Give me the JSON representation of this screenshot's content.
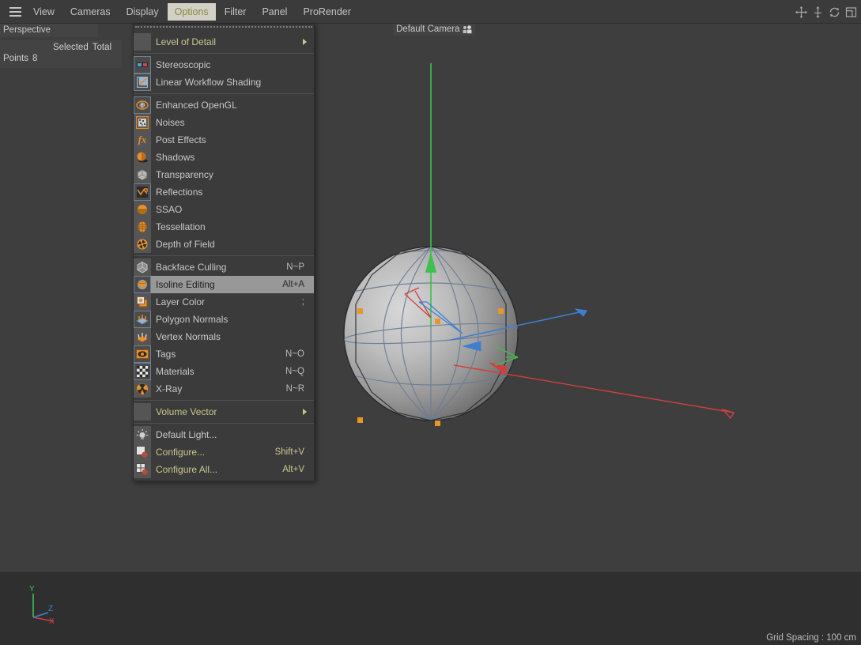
{
  "menubar": {
    "hamburger_icon": "hamburger-icon",
    "items": [
      {
        "label": "View",
        "active": false
      },
      {
        "label": "Cameras",
        "active": false
      },
      {
        "label": "Display",
        "active": false
      },
      {
        "label": "Options",
        "active": true
      },
      {
        "label": "Filter",
        "active": false
      },
      {
        "label": "Panel",
        "active": false
      },
      {
        "label": "ProRender",
        "active": false
      }
    ],
    "viewport_icons": [
      {
        "name": "pan-icon",
        "title": "Move"
      },
      {
        "name": "dolly-icon",
        "title": "Scale"
      },
      {
        "name": "rotate-icon",
        "title": "Rotate"
      },
      {
        "name": "maximize-icon",
        "title": "Toggle Active View"
      }
    ]
  },
  "viewport": {
    "perspective_label": "Perspective",
    "stats": {
      "col_selected": "Selected",
      "col_total": "Total",
      "row_label": "Points",
      "row_value": "8"
    },
    "camera_label": "Default Camera",
    "grid_spacing": "Grid Spacing : 100 cm",
    "axis": {
      "y": "Y",
      "x": "X",
      "z": "Z"
    },
    "colors": {
      "background_upper": "#3e3e3e",
      "background_lower": "#2f2f2f",
      "axis_x": "#d04040",
      "axis_y": "#3fc04f",
      "axis_z": "#3f7fd0",
      "point_marker": "#e8962a",
      "wireframe": "#6a7c96"
    }
  },
  "dropdown": {
    "tearoff": true,
    "groups": [
      {
        "items": [
          {
            "label": "Level of Detail",
            "shortcut": "",
            "icon": "lod-icon",
            "icon_style": "plain",
            "submenu": true,
            "gold": true,
            "highlight": false
          }
        ]
      },
      {
        "items": [
          {
            "label": "Stereoscopic",
            "shortcut": "",
            "icon": "stereo-glasses-icon",
            "icon_style": "framed",
            "submenu": false,
            "gold": false,
            "highlight": false
          },
          {
            "label": "Linear Workflow Shading",
            "shortcut": "",
            "icon": "linear-workflow-icon",
            "icon_style": "framed",
            "submenu": false,
            "gold": false,
            "highlight": false
          }
        ]
      },
      {
        "items": [
          {
            "label": "Enhanced OpenGL",
            "shortcut": "",
            "icon": "opengl-icon",
            "icon_style": "framed",
            "submenu": false,
            "gold": false,
            "highlight": false
          },
          {
            "label": "Noises",
            "shortcut": "",
            "icon": "noises-icon",
            "icon_style": "plain",
            "submenu": false,
            "gold": false,
            "highlight": false
          },
          {
            "label": "Post Effects",
            "shortcut": "",
            "icon": "fx-icon",
            "icon_style": "plain",
            "submenu": false,
            "gold": false,
            "highlight": false
          },
          {
            "label": "Shadows",
            "shortcut": "",
            "icon": "shadows-icon",
            "icon_style": "plain",
            "submenu": false,
            "gold": false,
            "highlight": false
          },
          {
            "label": "Transparency",
            "shortcut": "",
            "icon": "transparency-cube-icon",
            "icon_style": "plain",
            "submenu": false,
            "gold": false,
            "highlight": false
          },
          {
            "label": "Reflections",
            "shortcut": "",
            "icon": "reflections-icon",
            "icon_style": "framed",
            "submenu": false,
            "gold": false,
            "highlight": false
          },
          {
            "label": "SSAO",
            "shortcut": "",
            "icon": "ssao-icon",
            "icon_style": "plain",
            "submenu": false,
            "gold": false,
            "highlight": false
          },
          {
            "label": "Tessellation",
            "shortcut": "",
            "icon": "tessellation-icon",
            "icon_style": "plain",
            "submenu": false,
            "gold": false,
            "highlight": false
          },
          {
            "label": "Depth of Field",
            "shortcut": "",
            "icon": "aperture-icon",
            "icon_style": "plain",
            "submenu": false,
            "gold": false,
            "highlight": false
          }
        ]
      },
      {
        "items": [
          {
            "label": "Backface Culling",
            "shortcut": "N~P",
            "icon": "wire-cube-icon",
            "icon_style": "plain",
            "submenu": false,
            "gold": false,
            "highlight": false
          },
          {
            "label": "Isoline Editing",
            "shortcut": "Alt+A",
            "icon": "isoline-icon",
            "icon_style": "framed",
            "submenu": false,
            "gold": false,
            "highlight": true
          },
          {
            "label": "Layer Color",
            "shortcut": ";",
            "icon": "layer-color-icon",
            "icon_style": "plain",
            "submenu": false,
            "gold": false,
            "highlight": false
          },
          {
            "label": "Polygon Normals",
            "shortcut": "",
            "icon": "polygon-normals-icon",
            "icon_style": "framed",
            "submenu": false,
            "gold": false,
            "highlight": false
          },
          {
            "label": "Vertex Normals",
            "shortcut": "",
            "icon": "vertex-normals-icon",
            "icon_style": "plain",
            "submenu": false,
            "gold": false,
            "highlight": false
          },
          {
            "label": "Tags",
            "shortcut": "N~O",
            "icon": "eye-icon",
            "icon_style": "framed",
            "submenu": false,
            "gold": false,
            "highlight": false
          },
          {
            "label": "Materials",
            "shortcut": "N~Q",
            "icon": "checker-icon",
            "icon_style": "framed",
            "submenu": false,
            "gold": false,
            "highlight": false
          },
          {
            "label": "X-Ray",
            "shortcut": "N~R",
            "icon": "xray-icon",
            "icon_style": "plain",
            "submenu": false,
            "gold": false,
            "highlight": false
          }
        ]
      },
      {
        "items": [
          {
            "label": "Volume Vector",
            "shortcut": "",
            "icon": "volume-vector-icon",
            "icon_style": "plain",
            "submenu": true,
            "gold": true,
            "highlight": false
          }
        ]
      },
      {
        "items": [
          {
            "label": "Default Light...",
            "shortcut": "",
            "icon": "light-bulb-icon",
            "icon_style": "plain",
            "submenu": false,
            "gold": false,
            "highlight": false
          },
          {
            "label": "Configure...",
            "shortcut": "Shift+V",
            "icon": "configure-icon",
            "icon_style": "plain",
            "submenu": false,
            "gold": true,
            "highlight": false
          },
          {
            "label": "Configure All...",
            "shortcut": "Alt+V",
            "icon": "configure-all-icon",
            "icon_style": "plain",
            "submenu": false,
            "gold": true,
            "highlight": false
          }
        ]
      }
    ]
  }
}
